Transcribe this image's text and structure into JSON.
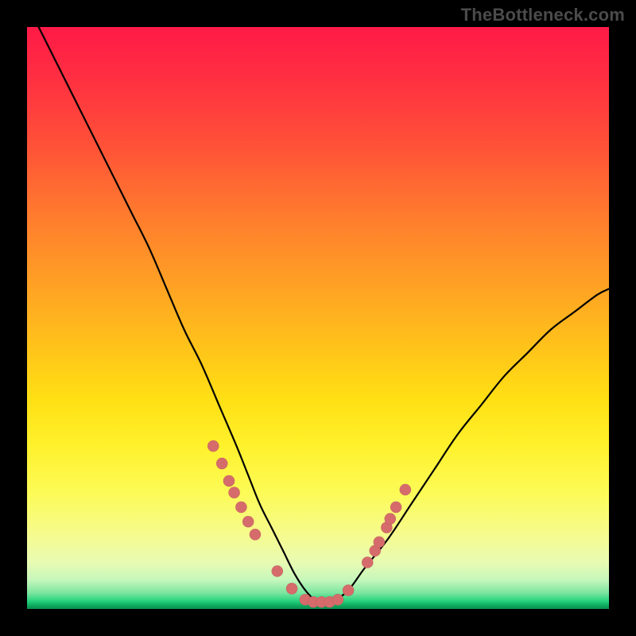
{
  "watermark": "TheBottleneck.com",
  "chart_data": {
    "type": "line",
    "title": "",
    "xlabel": "",
    "ylabel": "",
    "xlim": [
      0,
      100
    ],
    "ylim": [
      0,
      100
    ],
    "grid": false,
    "legend": false,
    "series": [
      {
        "name": "bottleneck-curve",
        "x": [
          0,
          3,
          6,
          9,
          12,
          15,
          18,
          21,
          24,
          27,
          30,
          33,
          36,
          38,
          40,
          42,
          44,
          46,
          48,
          50,
          52,
          55,
          58,
          62,
          66,
          70,
          74,
          78,
          82,
          86,
          90,
          94,
          98,
          100
        ],
        "y": [
          104,
          98,
          92,
          86,
          80,
          74,
          68,
          62,
          55,
          48,
          42,
          35,
          28,
          23,
          18,
          14,
          10,
          6,
          3,
          1.2,
          1.2,
          3,
          7,
          12,
          18,
          24,
          30,
          35,
          40,
          44,
          48,
          51,
          54,
          55
        ]
      }
    ],
    "markers": [
      {
        "x": 32.0,
        "y": 28.0
      },
      {
        "x": 33.5,
        "y": 25.0
      },
      {
        "x": 34.7,
        "y": 22.0
      },
      {
        "x": 35.6,
        "y": 20.0
      },
      {
        "x": 36.8,
        "y": 17.5
      },
      {
        "x": 38.0,
        "y": 15.0
      },
      {
        "x": 39.2,
        "y": 12.8
      },
      {
        "x": 43.0,
        "y": 6.5
      },
      {
        "x": 45.5,
        "y": 3.5
      },
      {
        "x": 47.8,
        "y": 1.6
      },
      {
        "x": 49.2,
        "y": 1.2
      },
      {
        "x": 50.6,
        "y": 1.2
      },
      {
        "x": 52.0,
        "y": 1.2
      },
      {
        "x": 53.4,
        "y": 1.6
      },
      {
        "x": 55.2,
        "y": 3.2
      },
      {
        "x": 58.5,
        "y": 8.0
      },
      {
        "x": 59.8,
        "y": 10.0
      },
      {
        "x": 60.5,
        "y": 11.5
      },
      {
        "x": 61.8,
        "y": 14.0
      },
      {
        "x": 62.4,
        "y": 15.5
      },
      {
        "x": 63.4,
        "y": 17.5
      },
      {
        "x": 65.0,
        "y": 20.5
      }
    ],
    "colors": {
      "curve": "#000000",
      "marker": "#d66b6b"
    }
  }
}
